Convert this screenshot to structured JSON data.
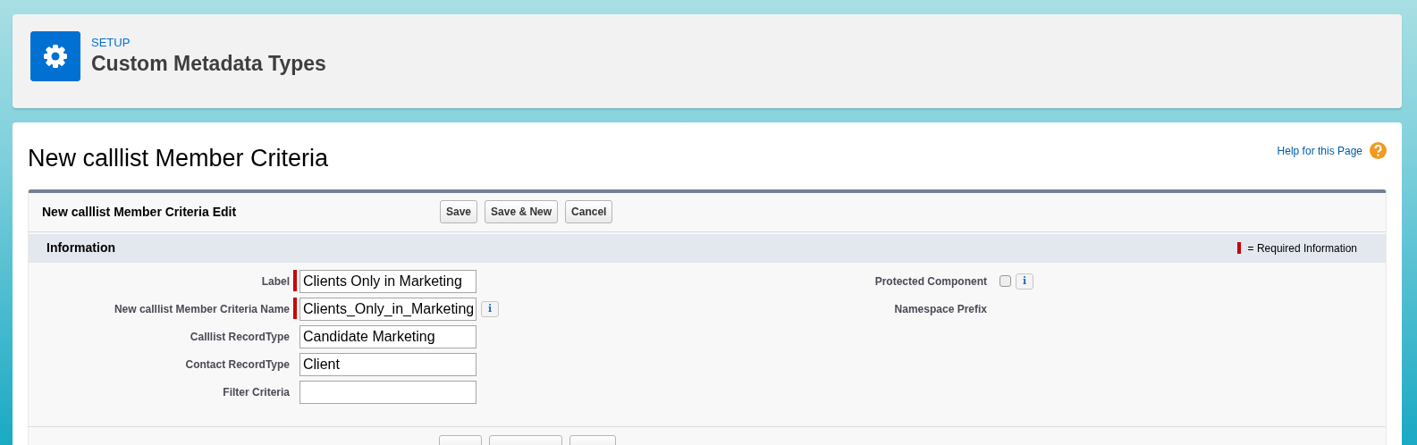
{
  "header": {
    "eyebrow": "SETUP",
    "title": "Custom Metadata Types"
  },
  "page_title": "New calllist Member Criteria",
  "help_link": "Help for this Page",
  "edit_block": {
    "title": "New calllist Member Criteria Edit",
    "buttons": [
      "Save",
      "Save & New",
      "Cancel"
    ],
    "section": {
      "title": "Information",
      "legend": "= Required Information"
    },
    "left_fields": [
      {
        "label": "Label",
        "value": "Clients Only in Marketing",
        "required": true
      },
      {
        "label": "New calllist Member Criteria Name",
        "value": "Clients_Only_in_Marketing",
        "required": true,
        "info_icon": "i"
      },
      {
        "label": "Calllist RecordType",
        "value": "Candidate Marketing",
        "required": false
      },
      {
        "label": "Contact RecordType",
        "value": "Client",
        "required": false
      },
      {
        "label": "Filter Criteria",
        "required": false
      }
    ],
    "right_fields": [
      {
        "label": "Protected Component",
        "kind": "checkbox",
        "checked": false,
        "info_icon": "i"
      },
      {
        "label": "Namespace Prefix",
        "kind": "text"
      }
    ],
    "footer_buttons": [
      {
        "kind": "button"
      },
      {
        "kind": "button"
      },
      {
        "kind": "button"
      }
    ]
  }
}
